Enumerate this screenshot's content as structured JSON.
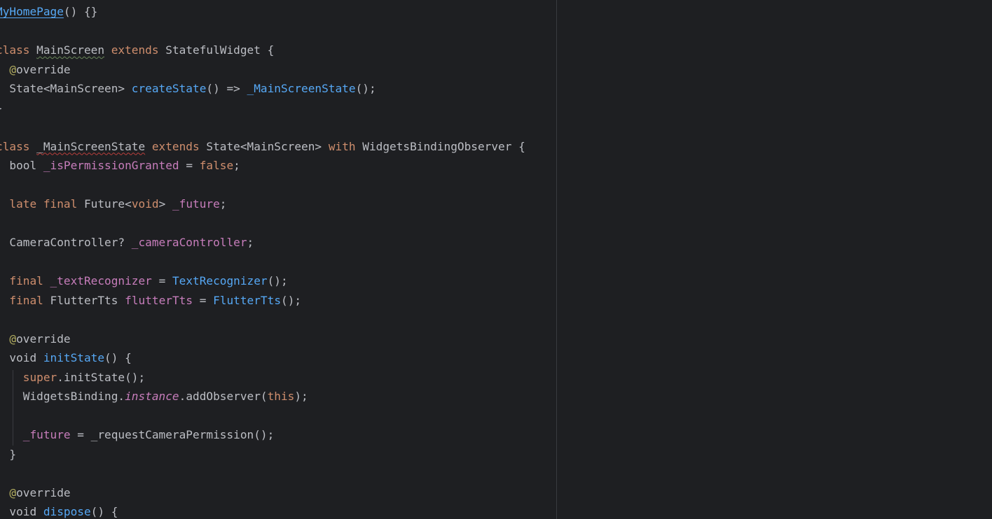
{
  "editor": {
    "lines": [
      [
        {
          "t": "MyHomePage",
          "c": "ref"
        },
        {
          "t": "() {}"
        }
      ],
      [],
      [
        {
          "t": "class ",
          "c": "kw"
        },
        {
          "t": "MainScreen",
          "c": "typo"
        },
        {
          "t": " extends ",
          "c": "kw"
        },
        {
          "t": "StatefulWidget {"
        }
      ],
      [
        {
          "t": "  "
        },
        {
          "t": "@",
          "c": "ann"
        },
        {
          "t": "override"
        }
      ],
      [
        {
          "t": "  State<MainScreen> "
        },
        {
          "t": "createState",
          "c": "fn"
        },
        {
          "t": "() => "
        },
        {
          "t": "_MainScreenState",
          "c": "fn"
        },
        {
          "t": "();"
        }
      ],
      [
        {
          "t": "}"
        }
      ],
      [],
      [
        {
          "t": "class ",
          "c": "kw"
        },
        {
          "t": "_MainScreenState",
          "c": "err"
        },
        {
          "t": " extends ",
          "c": "kw"
        },
        {
          "t": "State<MainScreen> "
        },
        {
          "t": "with ",
          "c": "kw"
        },
        {
          "t": "WidgetsBindingObserver {"
        }
      ],
      [
        {
          "t": "  bool "
        },
        {
          "t": "_isPermissionGranted",
          "c": "fld"
        },
        {
          "t": " = "
        },
        {
          "t": "false",
          "c": "kw"
        },
        {
          "t": ";"
        }
      ],
      [],
      [
        {
          "t": "  "
        },
        {
          "t": "late final ",
          "c": "kw"
        },
        {
          "t": "Future<"
        },
        {
          "t": "void",
          "c": "kw"
        },
        {
          "t": "> "
        },
        {
          "t": "_future",
          "c": "fld"
        },
        {
          "t": ";"
        }
      ],
      [],
      [
        {
          "t": "  CameraController? "
        },
        {
          "t": "_cameraController",
          "c": "fld"
        },
        {
          "t": ";"
        }
      ],
      [],
      [
        {
          "t": "  "
        },
        {
          "t": "final ",
          "c": "kw"
        },
        {
          "t": "_textRecognizer",
          "c": "fld"
        },
        {
          "t": " = "
        },
        {
          "t": "TextRecognizer",
          "c": "fn"
        },
        {
          "t": "();"
        }
      ],
      [
        {
          "t": "  "
        },
        {
          "t": "final ",
          "c": "kw"
        },
        {
          "t": "FlutterTts "
        },
        {
          "t": "flutterTts",
          "c": "fld"
        },
        {
          "t": " = "
        },
        {
          "t": "FlutterTts",
          "c": "fn"
        },
        {
          "t": "();"
        }
      ],
      [],
      [
        {
          "t": "  "
        },
        {
          "t": "@",
          "c": "ann"
        },
        {
          "t": "override"
        }
      ],
      [
        {
          "t": "  void "
        },
        {
          "t": "initState",
          "c": "fn"
        },
        {
          "t": "() {"
        }
      ],
      [
        {
          "t": "    "
        },
        {
          "t": "super",
          "c": "kw"
        },
        {
          "t": ".initState();"
        }
      ],
      [
        {
          "t": "    WidgetsBinding."
        },
        {
          "t": "instance",
          "c": "fld ital"
        },
        {
          "t": ".addObserver("
        },
        {
          "t": "this",
          "c": "kw"
        },
        {
          "t": ");"
        }
      ],
      [],
      [
        {
          "t": "    "
        },
        {
          "t": "_future",
          "c": "fld"
        },
        {
          "t": " = _requestCameraPermission();"
        }
      ],
      [
        {
          "t": "  }"
        }
      ],
      [],
      [
        {
          "t": "  "
        },
        {
          "t": "@",
          "c": "ann"
        },
        {
          "t": "override"
        }
      ],
      [
        {
          "t": "  void "
        },
        {
          "t": "dispose",
          "c": "fn"
        },
        {
          "t": "() {"
        }
      ]
    ]
  }
}
